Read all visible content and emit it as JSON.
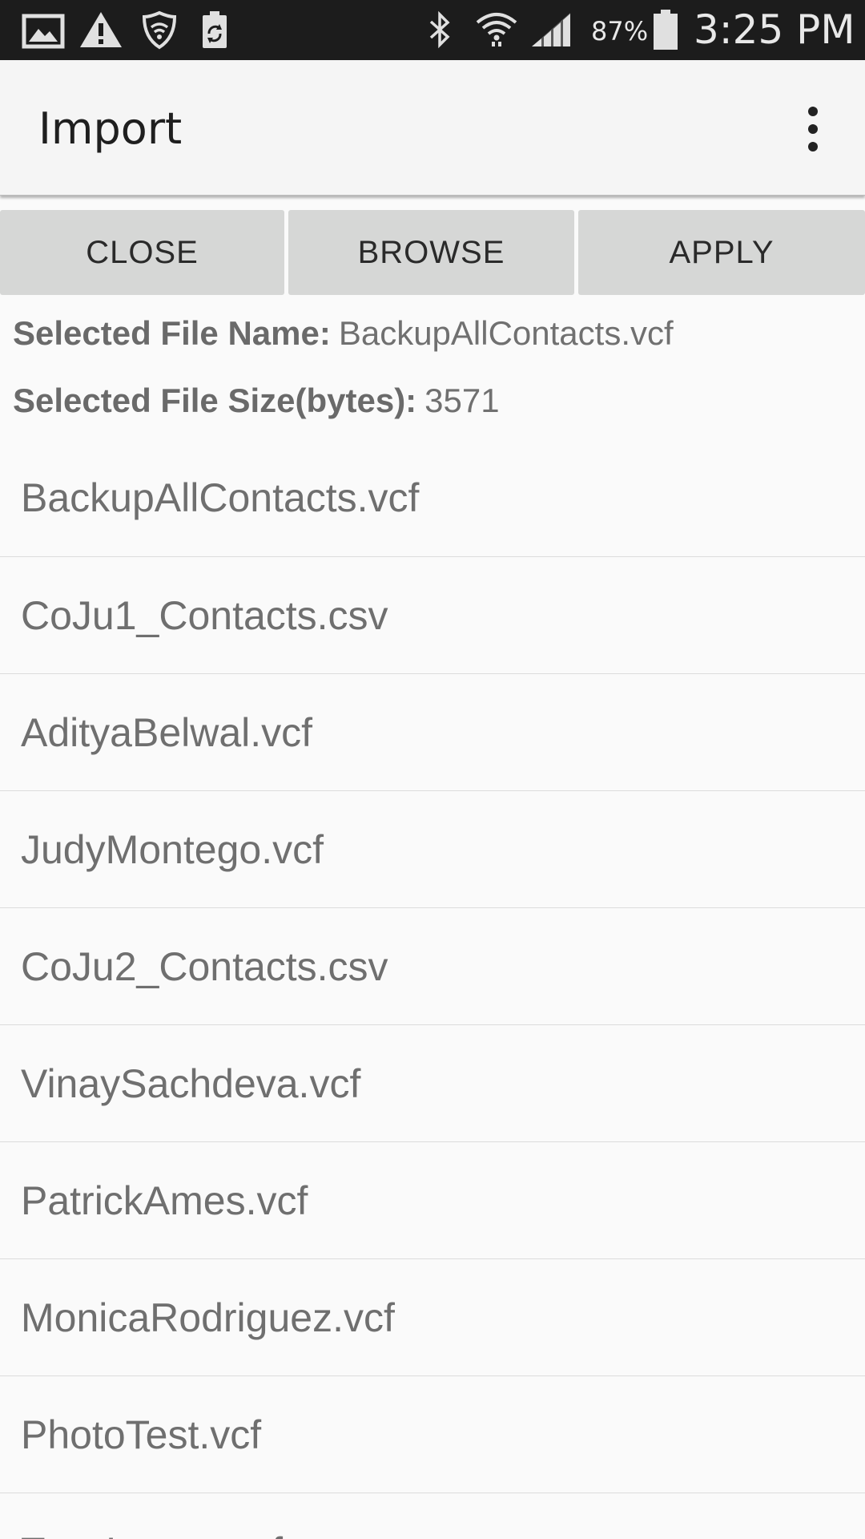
{
  "status_bar": {
    "icons": [
      "image-icon",
      "warning-icon",
      "vpn-shield-icon",
      "battery-recycle-icon",
      "bluetooth-icon",
      "wifi-icon",
      "cellular-signal-icon",
      "battery-icon"
    ],
    "battery_percent": "87%",
    "time": "3:25 PM"
  },
  "app_bar": {
    "title": "Import",
    "overflow_icon": "more-vertical-icon"
  },
  "actions": {
    "close_label": "CLOSE",
    "browse_label": "BROWSE",
    "apply_label": "APPLY"
  },
  "selected_file": {
    "name_label": "Selected File Name:",
    "name_value": "BackupAllContacts.vcf",
    "size_label": "Selected File Size(bytes):",
    "size_value": "3571"
  },
  "files": [
    "BackupAllContacts.vcf",
    "CoJu1_Contacts.csv",
    "AdityaBelwal.vcf",
    "JudyMontego.vcf",
    "CoJu2_Contacts.csv",
    "VinaySachdeva.vcf",
    "PatrickAmes.vcf",
    "MonicaRodriguez.vcf",
    "PhotoTest.vcf",
    "TonyIvanov.vcf"
  ],
  "colors": {
    "status_bar_bg": "#1c1c1c",
    "app_bar_bg": "#f5f5f5",
    "button_bg": "#d6d7d6",
    "page_bg": "#fafafa",
    "text_gray": "#6f6f6f"
  }
}
